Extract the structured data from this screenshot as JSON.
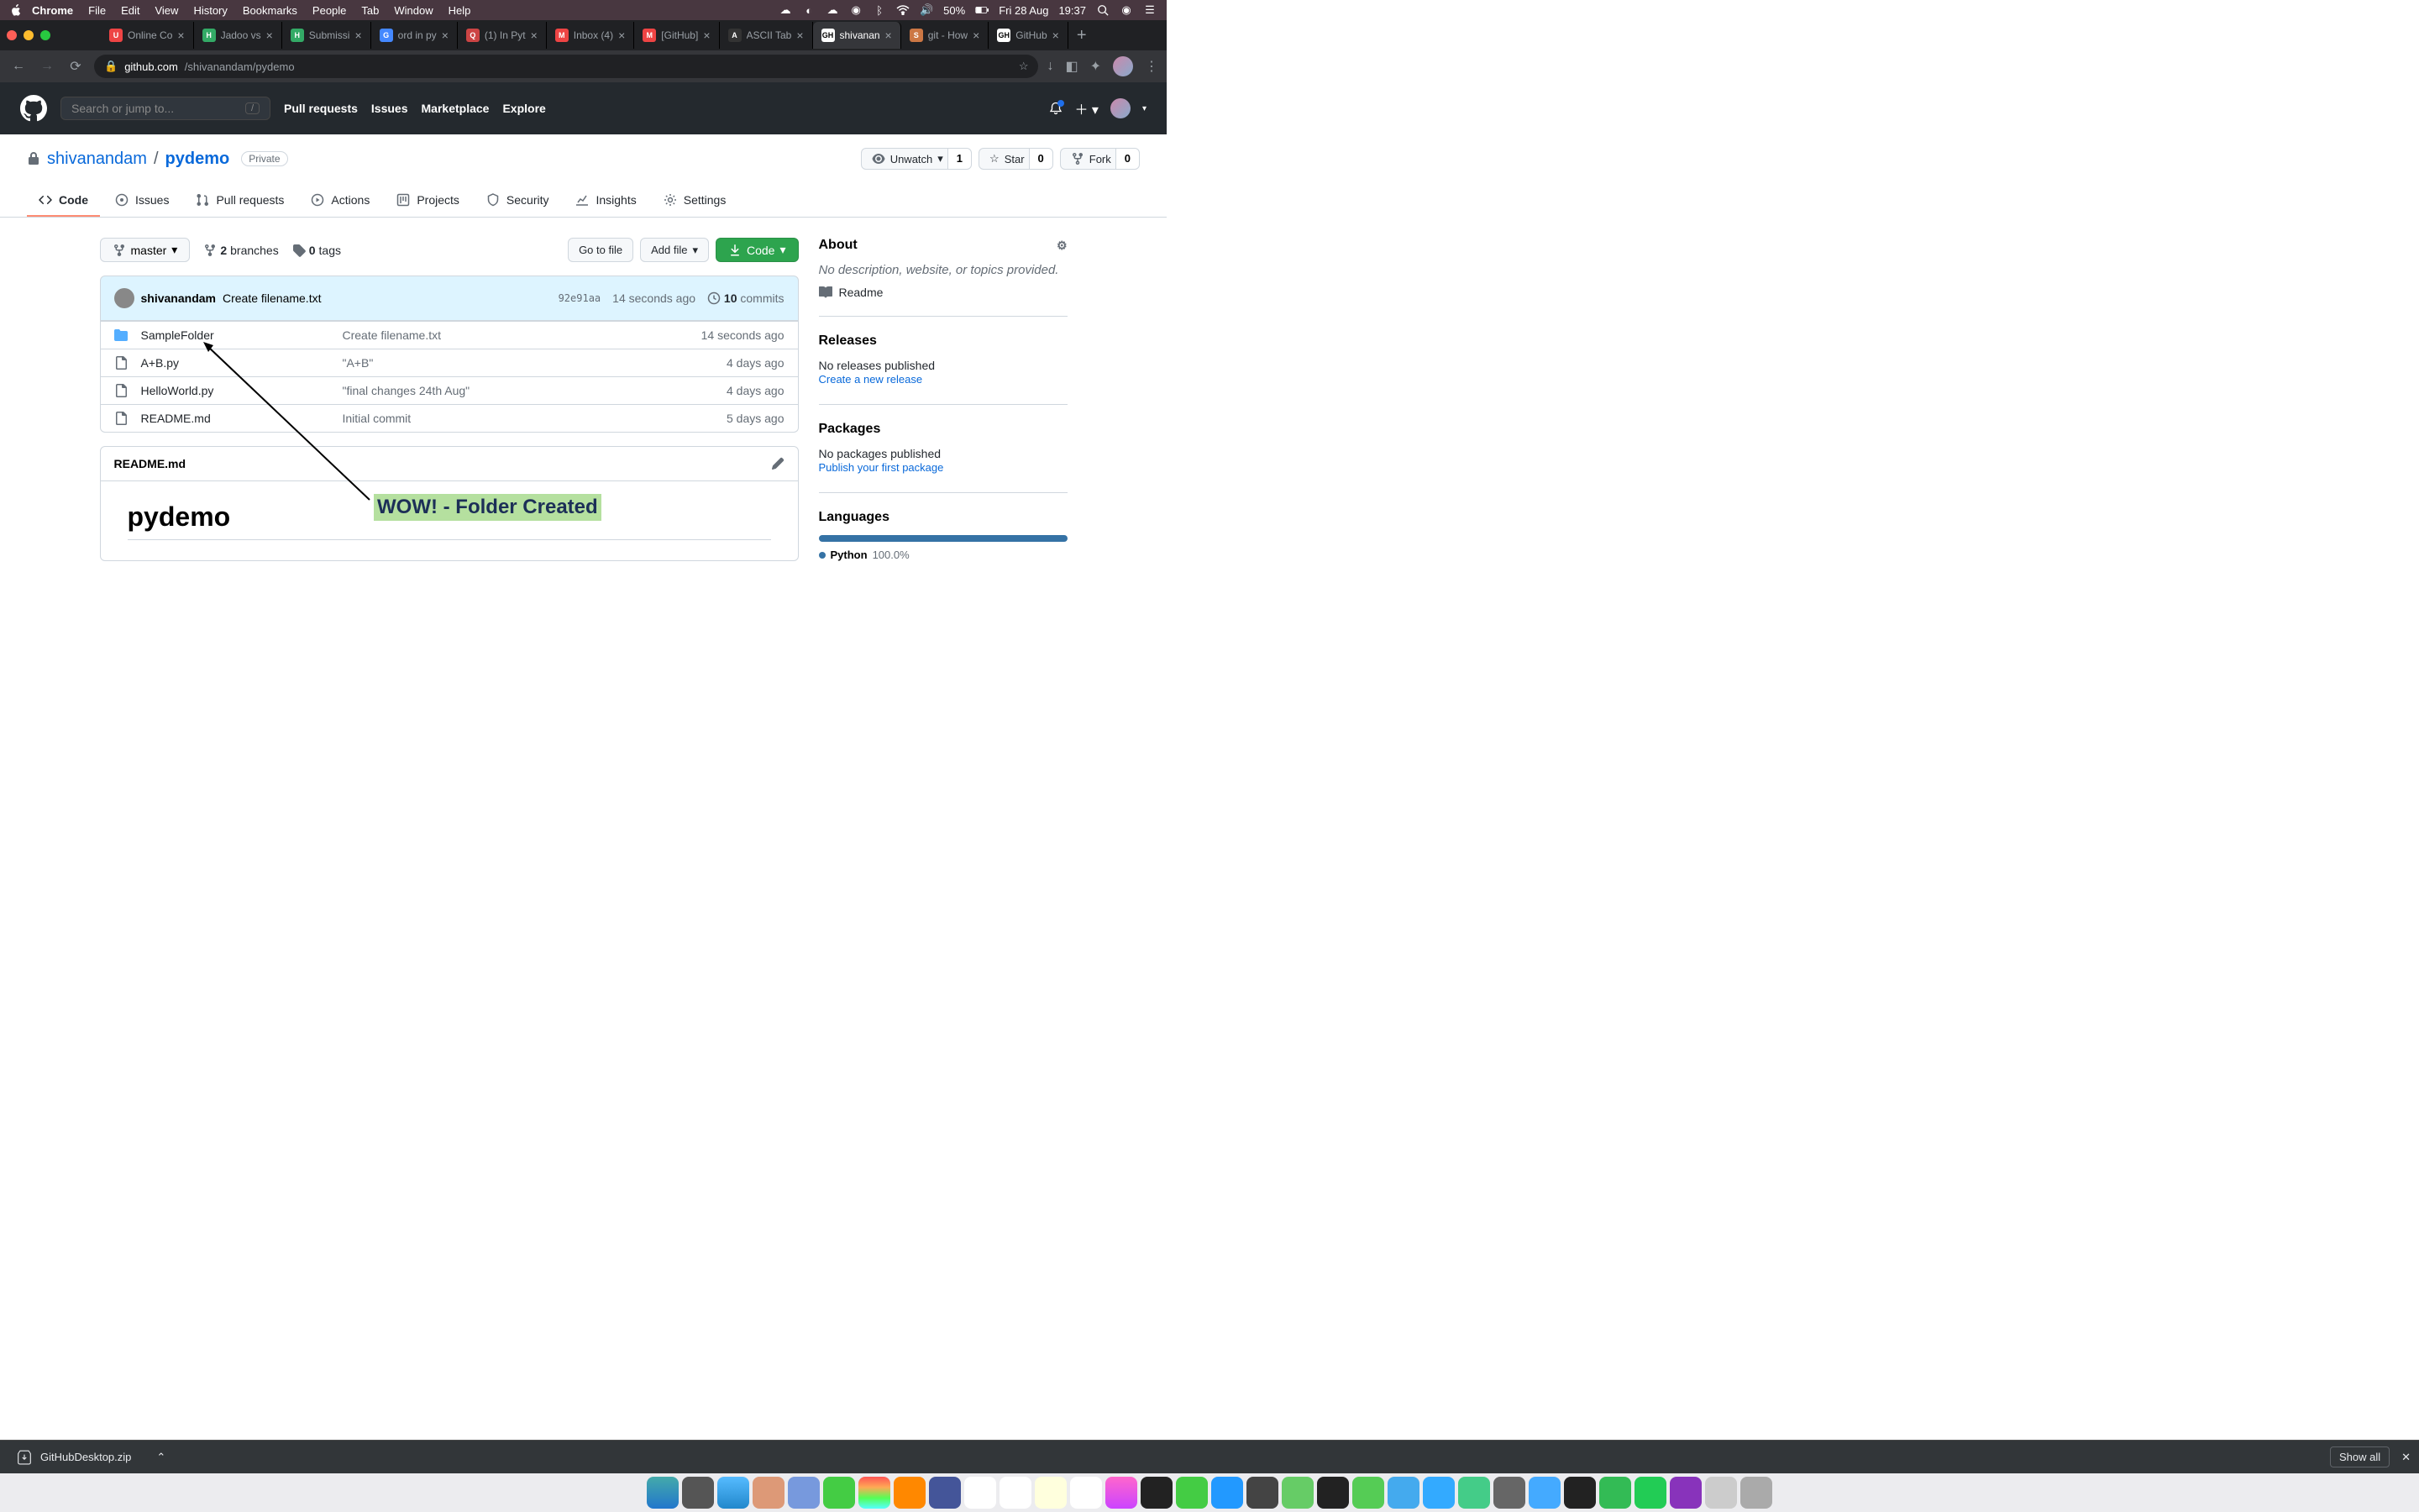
{
  "mac_menu": {
    "app": "Chrome",
    "items": [
      "File",
      "Edit",
      "View",
      "History",
      "Bookmarks",
      "People",
      "Tab",
      "Window",
      "Help"
    ],
    "battery": "50%",
    "date": "Fri 28 Aug",
    "time": "19:37"
  },
  "browser": {
    "tabs": [
      {
        "title": "Online Co",
        "favicon": "U"
      },
      {
        "title": "Jadoo vs",
        "favicon": "H"
      },
      {
        "title": "Submissi",
        "favicon": "H"
      },
      {
        "title": "ord in py",
        "favicon": "G"
      },
      {
        "title": "(1) In Pyt",
        "favicon": "Q"
      },
      {
        "title": "Inbox (4)",
        "favicon": "M"
      },
      {
        "title": "[GitHub]",
        "favicon": "M"
      },
      {
        "title": "ASCII Tab",
        "favicon": "A"
      },
      {
        "title": "shivanan",
        "favicon": "GH",
        "active": true
      },
      {
        "title": "git - How",
        "favicon": "S"
      },
      {
        "title": "GitHub",
        "favicon": "GH"
      }
    ],
    "url_host": "github.com",
    "url_path": "/shivanandam/pydemo"
  },
  "gh_header": {
    "search_placeholder": "Search or jump to...",
    "nav": [
      "Pull requests",
      "Issues",
      "Marketplace",
      "Explore"
    ]
  },
  "repo": {
    "owner": "shivanandam",
    "name": "pydemo",
    "visibility": "Private",
    "watch": {
      "label": "Unwatch",
      "count": "1"
    },
    "star": {
      "label": "Star",
      "count": "0"
    },
    "fork": {
      "label": "Fork",
      "count": "0"
    },
    "tabs": [
      {
        "label": "Code",
        "icon": "code",
        "active": true
      },
      {
        "label": "Issues",
        "icon": "issue"
      },
      {
        "label": "Pull requests",
        "icon": "pr"
      },
      {
        "label": "Actions",
        "icon": "actions"
      },
      {
        "label": "Projects",
        "icon": "projects"
      },
      {
        "label": "Security",
        "icon": "security"
      },
      {
        "label": "Insights",
        "icon": "insights"
      },
      {
        "label": "Settings",
        "icon": "settings"
      }
    ]
  },
  "file_nav": {
    "branch": "master",
    "branches_count": "2",
    "branches_label": "branches",
    "tags_count": "0",
    "tags_label": "tags",
    "goto": "Go to file",
    "add": "Add file",
    "code": "Code"
  },
  "commit_bar": {
    "author": "shivanandam",
    "message": "Create filename.txt",
    "hash": "92e91aa",
    "time": "14 seconds ago",
    "commits_count": "10",
    "commits_label": "commits"
  },
  "files": [
    {
      "type": "dir",
      "name": "SampleFolder",
      "msg": "Create filename.txt",
      "time": "14 seconds ago"
    },
    {
      "type": "file",
      "name": "A+B.py",
      "msg": "\"A+B\"",
      "time": "4 days ago"
    },
    {
      "type": "file",
      "name": "HelloWorld.py",
      "msg": "\"final changes 24th Aug\"",
      "time": "4 days ago"
    },
    {
      "type": "file",
      "name": "README.md",
      "msg": "Initial commit",
      "time": "5 days ago"
    }
  ],
  "readme": {
    "filename": "README.md",
    "heading": "pydemo"
  },
  "sidebar": {
    "about_title": "About",
    "about_desc": "No description, website, or topics provided.",
    "readme_link": "Readme",
    "releases_title": "Releases",
    "releases_none": "No releases published",
    "releases_create": "Create a new release",
    "packages_title": "Packages",
    "packages_none": "No packages published",
    "packages_publish": "Publish your first package",
    "languages_title": "Languages",
    "language_name": "Python",
    "language_pct": "100.0%"
  },
  "annotation": "WOW! - Folder Created",
  "download": {
    "filename": "GitHubDesktop.zip",
    "showall": "Show all"
  }
}
